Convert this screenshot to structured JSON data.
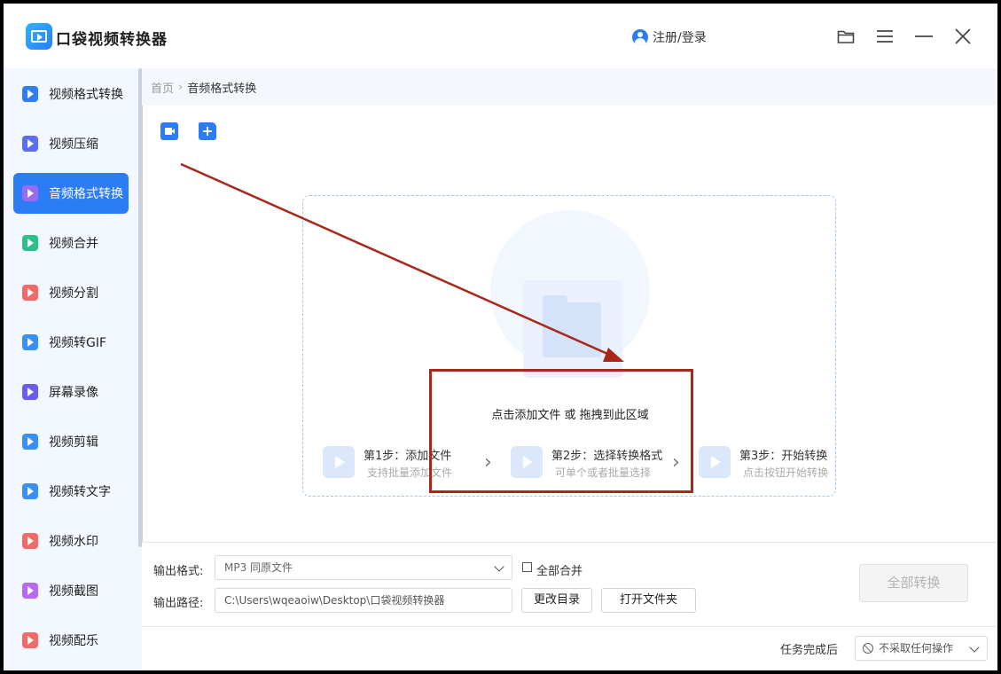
{
  "app": {
    "title": "口袋视频转换器",
    "login_label": "注册/登录"
  },
  "colors": {
    "accent": "#2c7cf6",
    "annotation": "#a8281c",
    "sidebar_bg": "#f3f8fe"
  },
  "sidebar": {
    "items": [
      {
        "label": "视频格式转换",
        "icon": "video-convert-icon",
        "color": "#2f7df3"
      },
      {
        "label": "视频压缩",
        "icon": "video-compress-icon",
        "color": "#5b6df0"
      },
      {
        "label": "音频格式转换",
        "icon": "audio-convert-icon",
        "color": "#9a6af2",
        "active": true
      },
      {
        "label": "视频合并",
        "icon": "video-merge-icon",
        "color": "#2bbf8a"
      },
      {
        "label": "视频分割",
        "icon": "video-split-icon",
        "color": "#f06a6a"
      },
      {
        "label": "视频转GIF",
        "icon": "video-gif-icon",
        "color": "#3a8ff5"
      },
      {
        "label": "屏幕录像",
        "icon": "screen-record-icon",
        "color": "#6a5cf0"
      },
      {
        "label": "视频剪辑",
        "icon": "video-edit-icon",
        "color": "#3a8ff5"
      },
      {
        "label": "视频转文字",
        "icon": "video-text-icon",
        "color": "#3a8ff5"
      },
      {
        "label": "视频水印",
        "icon": "video-watermark-icon",
        "color": "#f06a6a"
      },
      {
        "label": "视频截图",
        "icon": "video-screenshot-icon",
        "color": "#b56af0"
      },
      {
        "label": "视频配乐",
        "icon": "video-music-icon",
        "color": "#f06a6a"
      }
    ]
  },
  "breadcrumb": {
    "home": "首页",
    "separator": "›",
    "current": "音频格式转换"
  },
  "dropzone": {
    "hint": "点击添加文件  或  拖拽到此区域",
    "steps": [
      {
        "title": "第1步：添加文件",
        "desc": "支持批量添加文件"
      },
      {
        "title": "第2步：选择转换格式",
        "desc": "可单个或者批量选择"
      },
      {
        "title": "第3步：开始转换",
        "desc": "点击按钮开始转换"
      }
    ],
    "step_arrow": "›"
  },
  "settings": {
    "format_label": "输出格式:",
    "format_value": "MP3   同原文件",
    "merge_label": "全部合并",
    "path_label": "输出路径:",
    "path_value": "C:\\Users\\wqeaoiw\\Desktop\\口袋视频转换器",
    "change_dir": "更改目录",
    "open_folder": "打开文件夹",
    "convert_all": "全部转换"
  },
  "footer": {
    "after_label": "任务完成后",
    "after_value": "不采取任何操作"
  }
}
